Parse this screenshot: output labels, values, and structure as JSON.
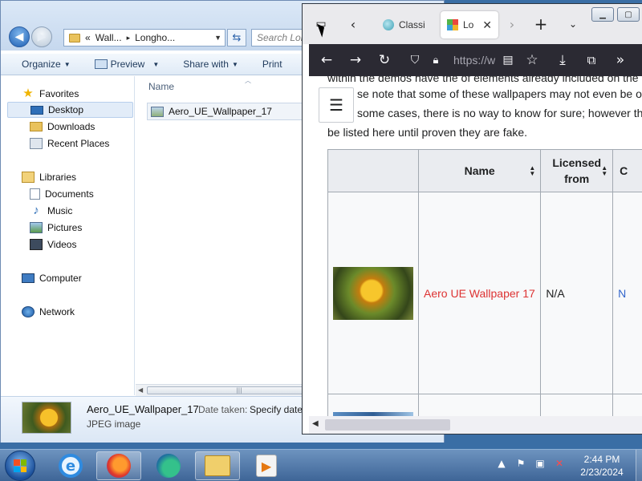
{
  "explorer": {
    "address": {
      "prefix": "«",
      "crumbs": [
        "Wall...",
        "Longho..."
      ],
      "separator": "▸"
    },
    "search_placeholder": "Search Lon",
    "toolbar": {
      "organize": "Organize",
      "preview": "Preview",
      "share_with": "Share with",
      "print": "Print"
    },
    "nav": {
      "favorites": "Favorites",
      "desktop": "Desktop",
      "downloads": "Downloads",
      "recent_places": "Recent Places",
      "libraries": "Libraries",
      "documents": "Documents",
      "music": "Music",
      "pictures": "Pictures",
      "videos": "Videos",
      "computer": "Computer",
      "network": "Network"
    },
    "columns": {
      "name": "Name"
    },
    "files": [
      {
        "name": "Aero_UE_Wallpaper_17"
      }
    ],
    "details": {
      "name": "Aero_UE_Wallpaper_17",
      "type": "JPEG image",
      "date_label": "Date taken:",
      "date_value": "Specify date"
    }
  },
  "browser": {
    "tabs": [
      {
        "label": "Classi",
        "favicon": "classic-globe"
      },
      {
        "label": "Lo",
        "favicon": "wiki-logo",
        "active": true
      }
    ],
    "url": "https://w",
    "paragraph_lines": [
      "within the demos have the of elements already included on the",
      "se note that some of these wallpapers may not even be of",
      "some cases, there is no way to know for sure; however th",
      "be listed here until proven they are fake."
    ],
    "table": {
      "headers": [
        "",
        "Name",
        "Licensed from",
        "C"
      ],
      "rows": [
        {
          "name": "Aero UE Wallpaper 17",
          "licensed_from": "N/A",
          "next_col": "N"
        }
      ]
    }
  },
  "taskbar": {
    "clock_time": "2:44 PM",
    "clock_date": "2/23/2024"
  },
  "colors": {
    "taskbar": "#3e6597",
    "firefox_toolbar": "#2b2a33",
    "wiki_red_link": "#dd3333",
    "wiki_header_bg": "#eaecf0"
  }
}
